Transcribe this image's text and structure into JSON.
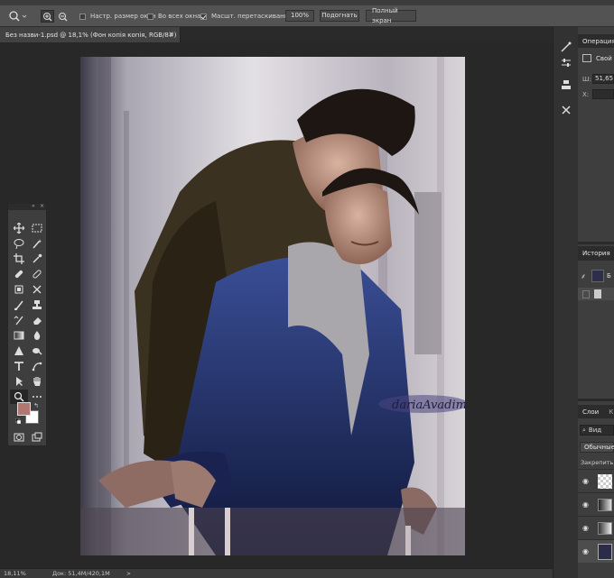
{
  "options_bar": {
    "resize_windows": "Настр. размер окон",
    "all_windows": "Во всех окнах",
    "scrubby_zoom": "Масшт. перетаскиванием",
    "zoom_value": "100%",
    "fit_button": "Подогнать",
    "fullscreen_button": "Полный экран"
  },
  "document_tab": {
    "title": "Без назви-1.psd @ 18,1% (Фон копія копія, RGB/8#)",
    "close": "×"
  },
  "artwork": {
    "signature": "dariaAvadim"
  },
  "statusbar": {
    "zoom": "18,11%",
    "doc_info": "Док: 51,4M/420,1M"
  },
  "panels": {
    "properties_tab": "Операция",
    "properties_sub": "Свой",
    "width_label": "Ш:",
    "width_value": "51,65",
    "x_label": "X:",
    "history_tab": "История",
    "history_item1": "Б",
    "layers_tab": "Слои",
    "layers_tab2": "К",
    "kind_filter": "Вид",
    "blend_mode": "Обычные",
    "lock_label": "Закрепить:"
  }
}
